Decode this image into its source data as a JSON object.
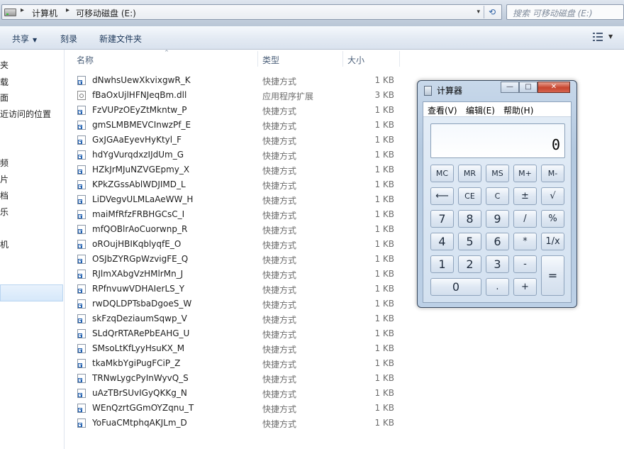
{
  "address": {
    "crumbs": [
      "计算机",
      "可移动磁盘 (E:)"
    ],
    "separator": "▸",
    "dropdown_glyph": "▾",
    "refresh_glyph": "⟲"
  },
  "search": {
    "placeholder": "搜索 可移动磁盘 (E:)"
  },
  "toolbar": {
    "share": "共享",
    "burn": "刻录",
    "new_folder": "新建文件夹",
    "caret": "▼"
  },
  "nav": {
    "items": [
      "夹",
      "载",
      "面",
      "近访问的位置",
      "频",
      "片",
      "档",
      "乐",
      "机"
    ]
  },
  "columns": {
    "name": "名称",
    "type": "类型",
    "size": "大小",
    "sort_glyph": "^"
  },
  "files": [
    {
      "name": "dNwhsUewXkvixgwR_K",
      "type": "快捷方式",
      "size": "1 KB",
      "icon": "shortcut-icon"
    },
    {
      "name": "fBaOxUjlHFNJeqBm.dll",
      "type": "应用程序扩展",
      "size": "3 KB",
      "icon": "dll-icon"
    },
    {
      "name": "FzVUPzOEyZtMkntw_P",
      "type": "快捷方式",
      "size": "1 KB",
      "icon": "shortcut-icon"
    },
    {
      "name": "gmSLMBMEVCInwzPf_E",
      "type": "快捷方式",
      "size": "1 KB",
      "icon": "shortcut-icon"
    },
    {
      "name": "GxJGAaEyevHyKtyl_F",
      "type": "快捷方式",
      "size": "1 KB",
      "icon": "shortcut-icon"
    },
    {
      "name": "hdYgVurqdxzIJdUm_G",
      "type": "快捷方式",
      "size": "1 KB",
      "icon": "shortcut-icon"
    },
    {
      "name": "HZkJrMJuNZVGEpmy_X",
      "type": "快捷方式",
      "size": "1 KB",
      "icon": "shortcut-icon"
    },
    {
      "name": "KPkZGssAblWDJIMD_L",
      "type": "快捷方式",
      "size": "1 KB",
      "icon": "shortcut-icon"
    },
    {
      "name": "LiDVegvULMLaAeWW_H",
      "type": "快捷方式",
      "size": "1 KB",
      "icon": "shortcut-icon"
    },
    {
      "name": "maiMfRfzFRBHGCsC_I",
      "type": "快捷方式",
      "size": "1 KB",
      "icon": "shortcut-icon"
    },
    {
      "name": "mfQOBlrAoCuorwnp_R",
      "type": "快捷方式",
      "size": "1 KB",
      "icon": "shortcut-icon"
    },
    {
      "name": "oROujHBIKqblyqfE_O",
      "type": "快捷方式",
      "size": "1 KB",
      "icon": "shortcut-icon"
    },
    {
      "name": "OSJbZYRGpWzvigFE_Q",
      "type": "快捷方式",
      "size": "1 KB",
      "icon": "shortcut-icon"
    },
    {
      "name": "RJlmXAbgVzHMlrMn_J",
      "type": "快捷方式",
      "size": "1 KB",
      "icon": "shortcut-icon"
    },
    {
      "name": "RPfnvuwVDHAIerLS_Y",
      "type": "快捷方式",
      "size": "1 KB",
      "icon": "shortcut-icon"
    },
    {
      "name": "rwDQLDPTsbaDgoeS_W",
      "type": "快捷方式",
      "size": "1 KB",
      "icon": "shortcut-icon"
    },
    {
      "name": "skFzqDeziaumSqwp_V",
      "type": "快捷方式",
      "size": "1 KB",
      "icon": "shortcut-icon"
    },
    {
      "name": "SLdQrRTARePbEAHG_U",
      "type": "快捷方式",
      "size": "1 KB",
      "icon": "shortcut-icon"
    },
    {
      "name": "SMsoLtKfLyyHsuKX_M",
      "type": "快捷方式",
      "size": "1 KB",
      "icon": "shortcut-icon"
    },
    {
      "name": "tkaMkbYgiPugFCiP_Z",
      "type": "快捷方式",
      "size": "1 KB",
      "icon": "shortcut-icon"
    },
    {
      "name": "TRNwLygcPyInWyvQ_S",
      "type": "快捷方式",
      "size": "1 KB",
      "icon": "shortcut-icon"
    },
    {
      "name": "uAzTBrSUvIGyQKKg_N",
      "type": "快捷方式",
      "size": "1 KB",
      "icon": "shortcut-icon"
    },
    {
      "name": "WEnQzrtGGmOYZqnu_T",
      "type": "快捷方式",
      "size": "1 KB",
      "icon": "shortcut-icon"
    },
    {
      "name": "YoFuaCMtphqAKJLm_D",
      "type": "快捷方式",
      "size": "1 KB",
      "icon": "shortcut-icon"
    }
  ],
  "calculator": {
    "title": "计算器",
    "menu": [
      "查看(V)",
      "编辑(E)",
      "帮助(H)"
    ],
    "display": "0",
    "window_buttons": {
      "minimize": "—",
      "maximize": "□",
      "close": "✕"
    },
    "keys": [
      {
        "id": "mc",
        "label": "MC"
      },
      {
        "id": "mr",
        "label": "MR"
      },
      {
        "id": "ms",
        "label": "MS"
      },
      {
        "id": "mplus",
        "label": "M+"
      },
      {
        "id": "mminus",
        "label": "M-"
      },
      {
        "id": "backspace",
        "label": "⟵"
      },
      {
        "id": "ce",
        "label": "CE"
      },
      {
        "id": "c",
        "label": "C"
      },
      {
        "id": "plusminus",
        "label": "±"
      },
      {
        "id": "sqrt",
        "label": "√"
      },
      {
        "id": "7",
        "label": "7"
      },
      {
        "id": "8",
        "label": "8"
      },
      {
        "id": "9",
        "label": "9"
      },
      {
        "id": "divide",
        "label": "/"
      },
      {
        "id": "percent",
        "label": "%"
      },
      {
        "id": "4",
        "label": "4"
      },
      {
        "id": "5",
        "label": "5"
      },
      {
        "id": "6",
        "label": "6"
      },
      {
        "id": "multiply",
        "label": "*"
      },
      {
        "id": "reciprocal",
        "label": "1/x"
      },
      {
        "id": "1",
        "label": "1"
      },
      {
        "id": "2",
        "label": "2"
      },
      {
        "id": "3",
        "label": "3"
      },
      {
        "id": "minus",
        "label": "-"
      },
      {
        "id": "equals",
        "label": "="
      },
      {
        "id": "0",
        "label": "0"
      },
      {
        "id": "decimal",
        "label": "."
      },
      {
        "id": "plus",
        "label": "+"
      }
    ]
  },
  "colors": {
    "accent": "#1e395b",
    "selection": "#d6e8fa",
    "close_red": "#c7452f"
  }
}
